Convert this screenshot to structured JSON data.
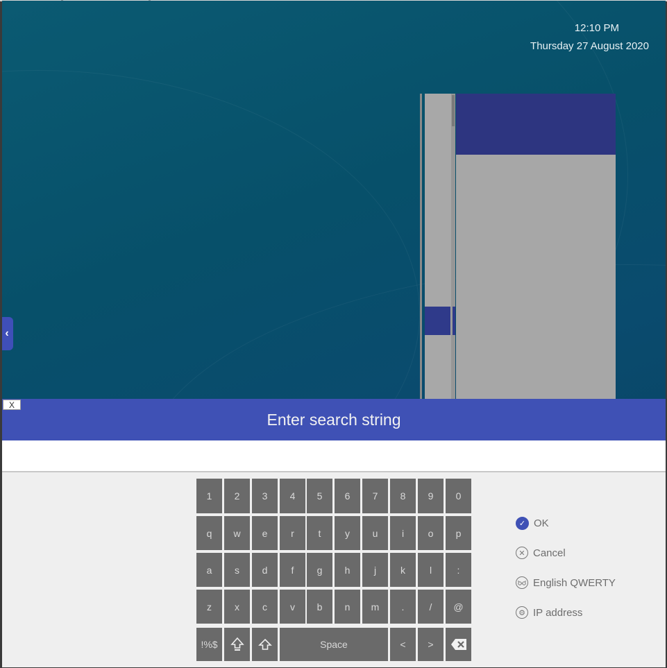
{
  "clock": {
    "time": "12:10 PM",
    "date": "Thursday 27 August 2020"
  },
  "keyboard": {
    "title": "Enter search string",
    "close_label": "X",
    "input_value": "",
    "rows": [
      [
        "1",
        "2",
        "3",
        "4",
        "5",
        "6",
        "7",
        "8",
        "9",
        "0"
      ],
      [
        "q",
        "w",
        "e",
        "r",
        "t",
        "y",
        "u",
        "i",
        "o",
        "p"
      ],
      [
        "a",
        "s",
        "d",
        "f",
        "g",
        "h",
        "j",
        "k",
        "l",
        ":"
      ],
      [
        "z",
        "x",
        "c",
        "v",
        "b",
        "n",
        "m",
        ".",
        "/",
        "@"
      ]
    ],
    "bottom": {
      "symbols": "!%$",
      "space": "Space",
      "left": "<",
      "right": ">"
    },
    "options": {
      "ok": "OK",
      "cancel": "Cancel",
      "layout": "English QWERTY",
      "ip": "IP address"
    }
  }
}
